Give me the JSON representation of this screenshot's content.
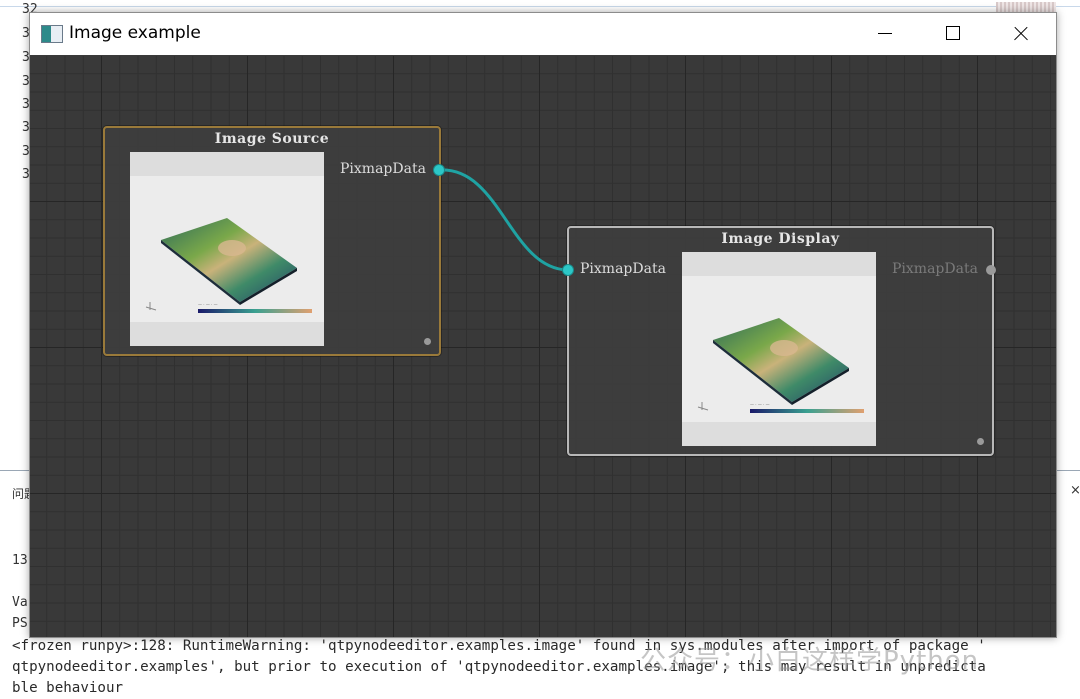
{
  "background_ide": {
    "gutter_numbers": [
      "32",
      "3",
      "3",
      "3",
      "3",
      "3",
      "3",
      "3"
    ],
    "panel_tab": "问题",
    "panel_close": "×",
    "line_13": "13",
    "line_va": "Va",
    "line_ps": "PS",
    "terminal_lines": [
      "<frozen runpy>:128: RuntimeWarning: 'qtpynodeeditor.examples.image' found in sys.modules after import of package '",
      "qtpynodeeditor.examples', but prior to execution of 'qtpynodeeditor.examples.image'; this may result in unpredicta",
      "ble behaviour"
    ],
    "watermark": "公众号：小白这样学Python"
  },
  "window": {
    "title": "Image example",
    "icon": "app-window-icon",
    "controls": [
      "minimize-icon",
      "maximize-icon",
      "close-icon"
    ]
  },
  "canvas": {
    "grid_color": "#262626",
    "background_color": "#393939",
    "connection_color": "#1fa3a3",
    "nodes": {
      "source": {
        "title": "Image Source",
        "output_port": "PixmapData",
        "border_color": "#9a7a3a"
      },
      "display": {
        "title": "Image Display",
        "input_port": "PixmapData",
        "output_port": "PixmapData",
        "border_color": "#b8b8b8"
      }
    }
  }
}
